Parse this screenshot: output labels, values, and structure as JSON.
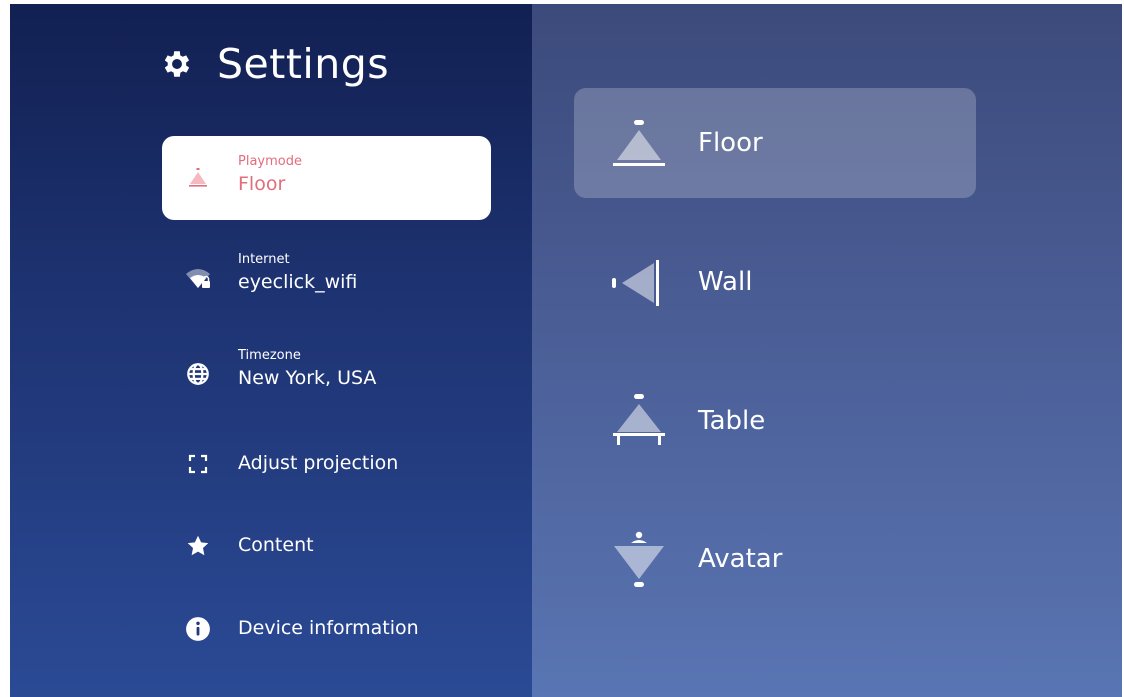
{
  "header": {
    "title": "Settings",
    "icon": "gear-icon"
  },
  "menu": {
    "items": [
      {
        "label": "Playmode",
        "value": "Floor",
        "icon": "projector-floor-icon",
        "active": true
      },
      {
        "label": "Internet",
        "value": "eyeclick_wifi",
        "icon": "wifi-lock-icon"
      },
      {
        "label": "Timezone",
        "value": "New York, USA",
        "icon": "globe-icon"
      },
      {
        "label": "Adjust projection",
        "icon": "frame-corners-icon"
      },
      {
        "label": "Content",
        "icon": "star-icon"
      },
      {
        "label": "Device information",
        "icon": "info-icon"
      }
    ]
  },
  "modes": {
    "selected": "Floor",
    "items": [
      {
        "label": "Floor",
        "icon": "floor-projection-icon"
      },
      {
        "label": "Wall",
        "icon": "wall-projection-icon"
      },
      {
        "label": "Table",
        "icon": "table-projection-icon"
      },
      {
        "label": "Avatar",
        "icon": "avatar-projection-icon"
      }
    ]
  },
  "colors": {
    "accent": "#e26d7b",
    "left_panel_top": "#122052",
    "left_panel_bottom": "#2b4a95",
    "right_panel_top": "#3c4a7b",
    "right_panel_bottom": "#5975b3"
  }
}
